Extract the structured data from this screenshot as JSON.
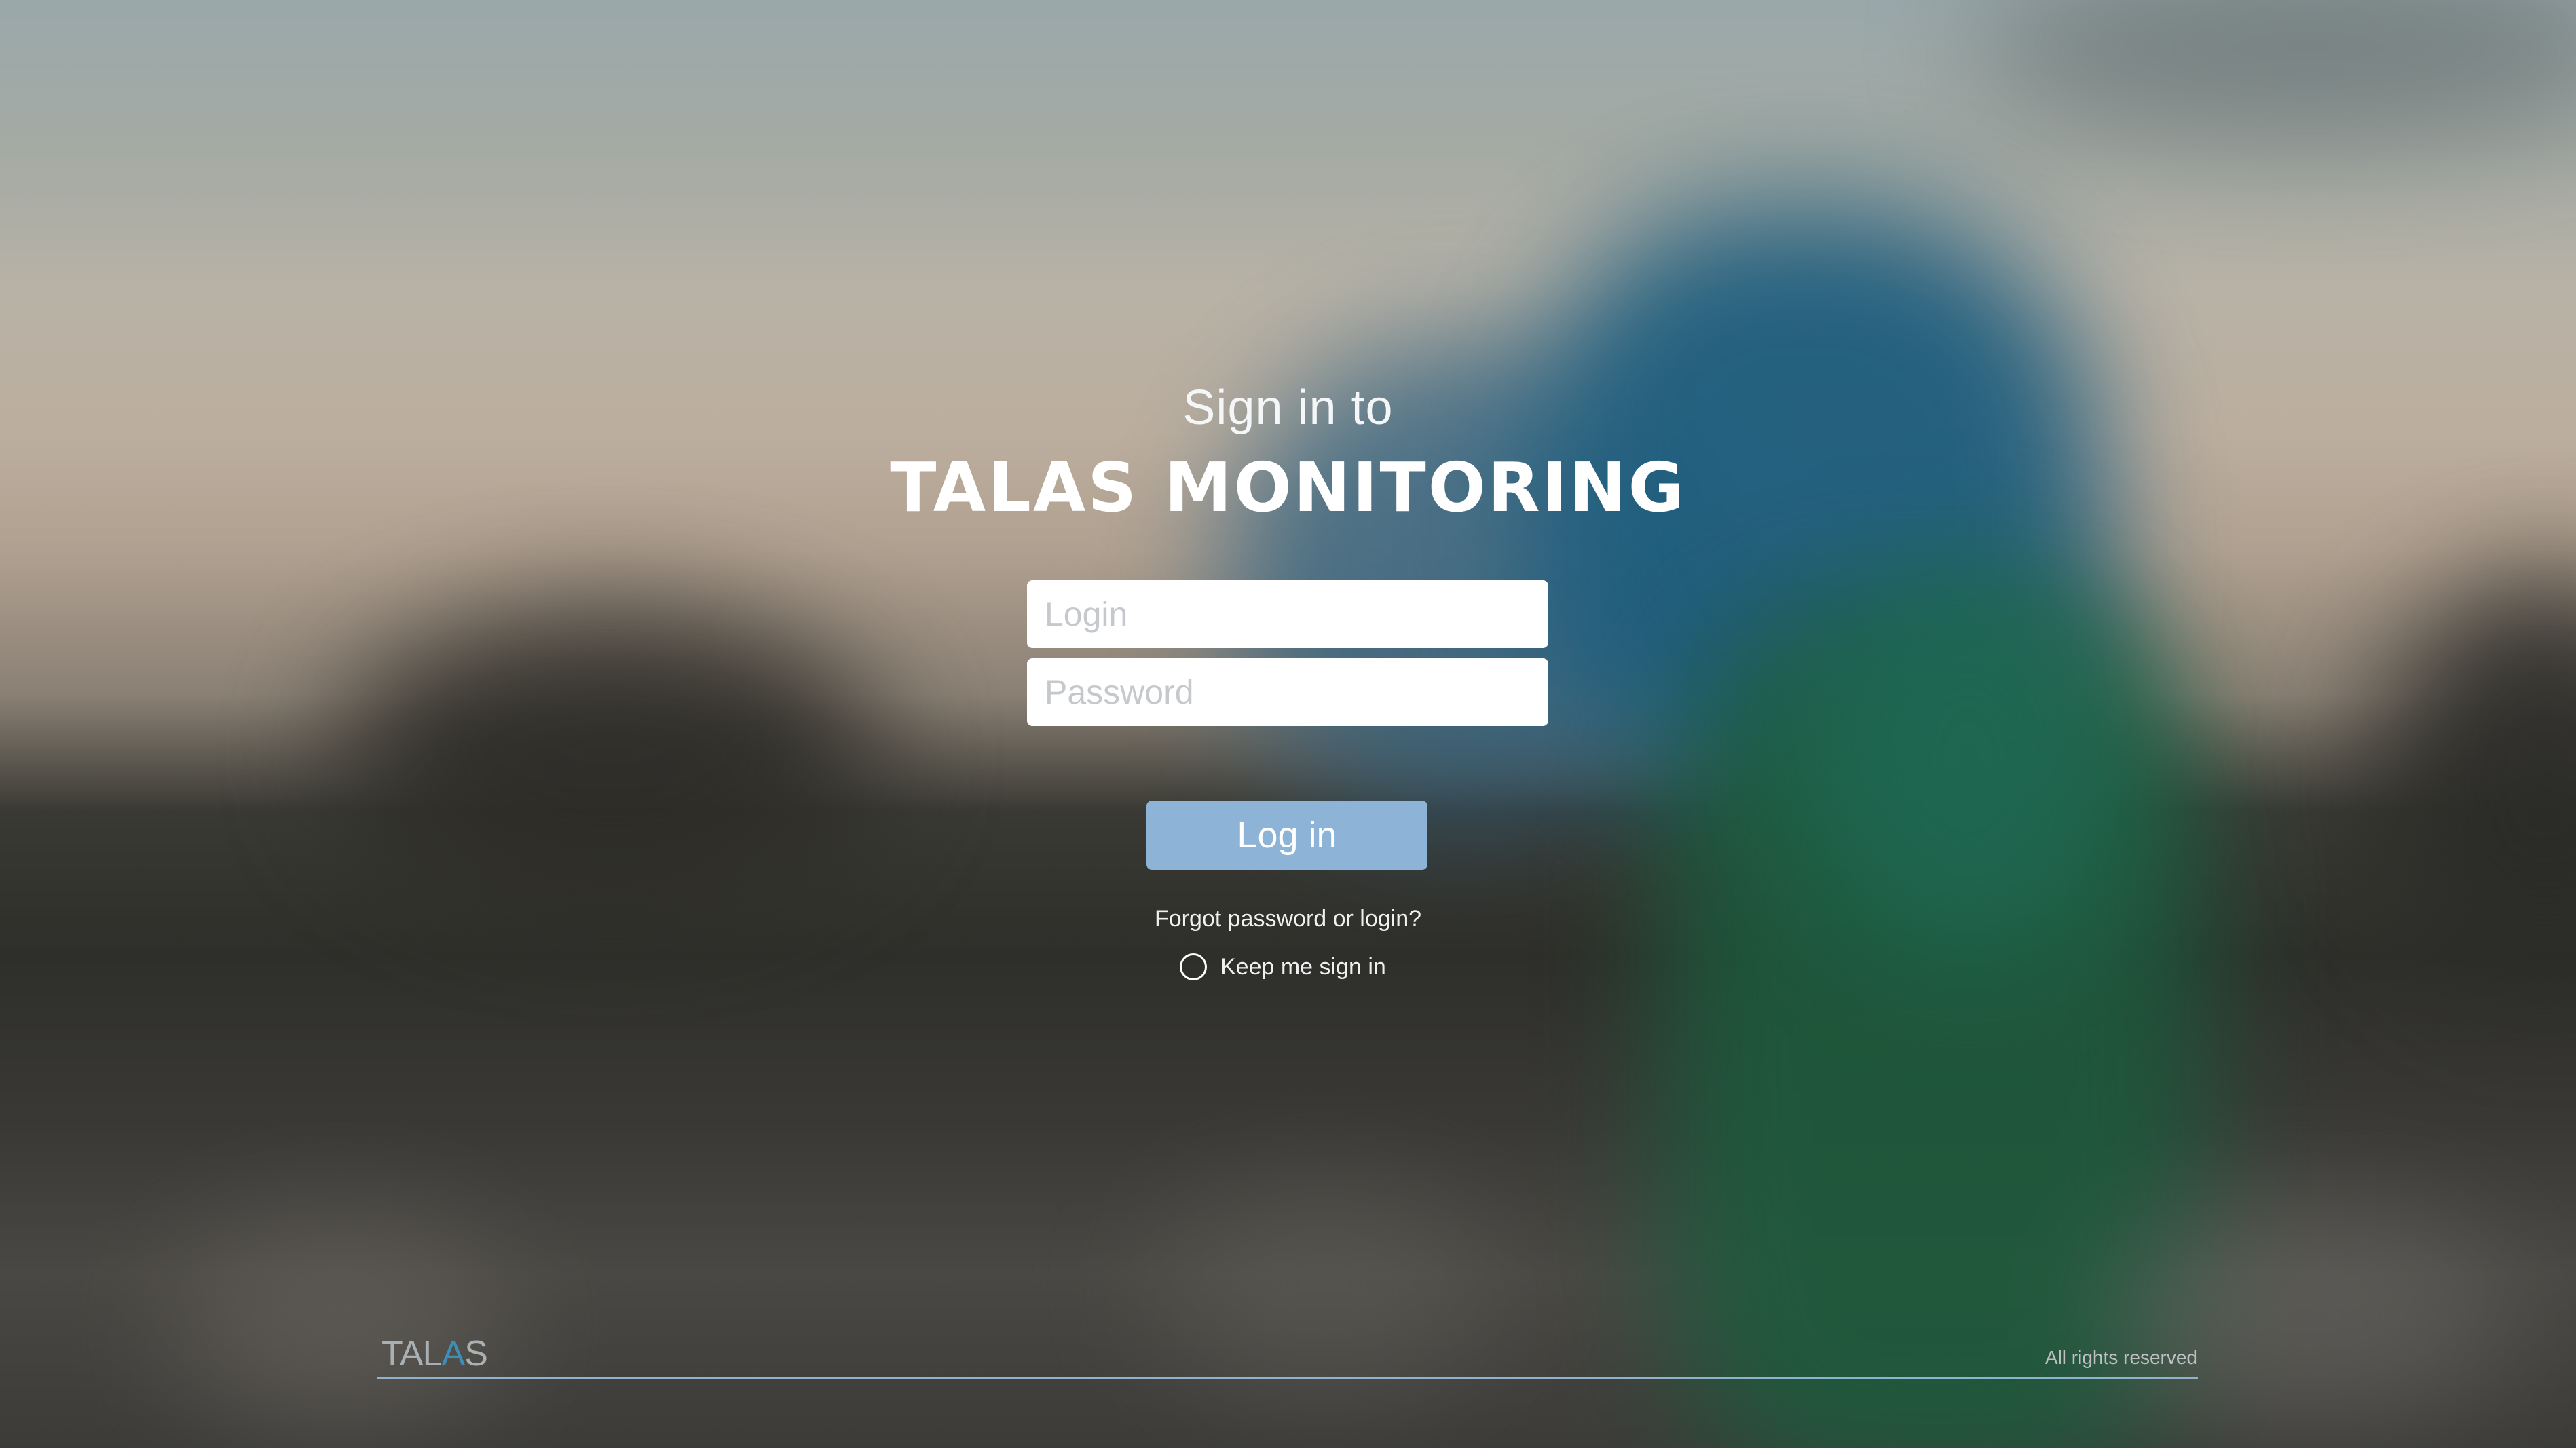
{
  "header": {
    "subtitle": "Sign in to",
    "title": "TALAS MONITORING"
  },
  "form": {
    "login_placeholder": "Login",
    "login_value": "",
    "password_placeholder": "Password",
    "password_value": "",
    "submit_label": "Log in",
    "forgot_link": "Forgot password or login?",
    "keep_signed_in_label": "Keep me sign in",
    "keep_signed_in_checked": false
  },
  "footer": {
    "logo_text_a": "TAL",
    "logo_text_b": "A",
    "logo_text_c": "S",
    "rights": "All rights reserved"
  },
  "colors": {
    "button_bg": "#8db3d6",
    "footer_line": "#8fb3cf",
    "logo_accent": "#3d8fb8"
  }
}
